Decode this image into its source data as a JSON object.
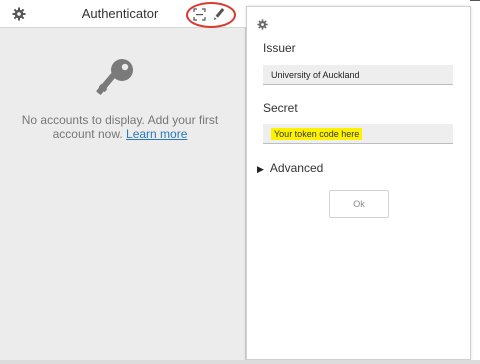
{
  "auth_popup": {
    "title": "Authenticator",
    "empty_message_line1": "No accounts to display. Add your first",
    "empty_message_line2": "account now.",
    "learn_more_link": "Learn more",
    "icons": {
      "settings": "gear-icon",
      "scan": "scan-qr-icon",
      "edit": "pencil-icon",
      "placeholder": "key-icon"
    },
    "highlight_color": "#d93a2f"
  },
  "add_account_form": {
    "settings_icon": "gear-icon",
    "issuer_label": "Issuer",
    "issuer_value": "University of Auckland",
    "secret_label": "Secret",
    "secret_value": "Your token code here",
    "secret_highlight_color": "#fff200",
    "advanced_label": "Advanced",
    "ok_button_label": "Ok"
  }
}
